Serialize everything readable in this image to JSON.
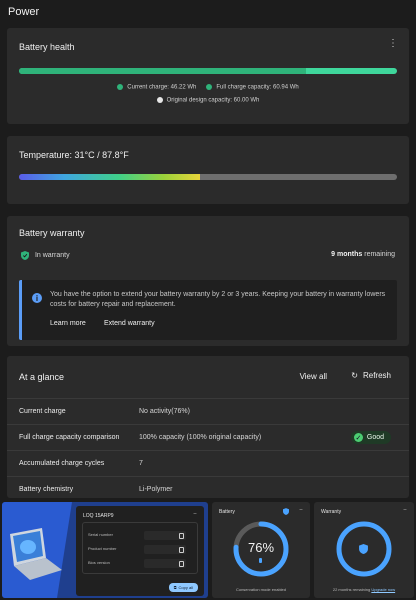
{
  "page": {
    "title": "Power"
  },
  "battery_health": {
    "title": "Battery health",
    "menu": "⋮",
    "current_charge_fraction": 0.76,
    "legend": [
      {
        "label": "Current charge: 46.22 Wh",
        "color": "#2fb37a"
      },
      {
        "label": "Full charge capacity: 60.94 Wh",
        "color": "#2fb37a"
      },
      {
        "label": "Original design capacity: 60.00 Wh",
        "color": "#e6e6e6"
      }
    ],
    "bar_colors": {
      "fill": "#2fb37a",
      "rest": "#3fd79c"
    }
  },
  "temperature": {
    "title": "Temperature:",
    "value": "31°C / 87.8°F",
    "level_fraction": 0.48
  },
  "warranty": {
    "title": "Battery warranty",
    "status": "In warranty",
    "remaining_value": "9 months",
    "remaining_suffix": "remaining",
    "info_text": "You have the option to extend your battery warranty by 2 or 3 years. Keeping your battery in warranty lowers costs for battery repair and replacement.",
    "learn_more": "Learn more",
    "extend": "Extend warranty",
    "accent": "#5b9df7"
  },
  "glance": {
    "title": "At a glance",
    "view_all": "View all",
    "refresh": "Refresh",
    "rows": [
      {
        "label": "Current charge",
        "value": "No activity(76%)"
      },
      {
        "label": "Full charge capacity comparison",
        "value": "100% capacity (100% original capacity)",
        "badge": "Good"
      },
      {
        "label": "Accumulated charge cycles",
        "value": "7"
      },
      {
        "label": "Battery chemistry",
        "value": "Li-Polymer"
      }
    ]
  },
  "widgets": {
    "device": {
      "title": "LOQ 15ARP9",
      "fields": [
        "Serial number",
        "Product number",
        "Bios version"
      ],
      "copy_all": "Copy all"
    },
    "battery": {
      "title": "Battery",
      "percent": "76%",
      "level_fraction": 0.76,
      "caption": "Conservation mode enabled"
    },
    "warranty": {
      "title": "Warranty",
      "caption_prefix": "22 months remaining",
      "caption_link": "Upgrade now"
    }
  }
}
